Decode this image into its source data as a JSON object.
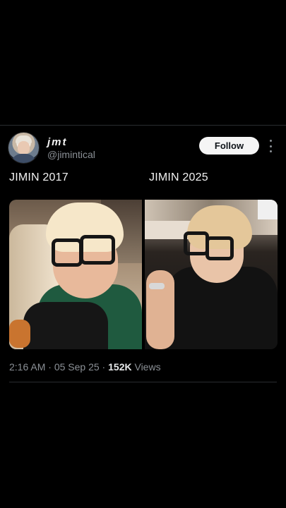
{
  "post": {
    "author": {
      "display_name": "jmt",
      "handle": "@jimintical"
    },
    "follow_label": "Follow",
    "more_icon": "more-vertical-icon",
    "captions": {
      "left": "JIMIN 2017",
      "right": "JIMIN 2025"
    },
    "meta": {
      "time": "2:16 AM",
      "separator1": " · ",
      "date": "05 Sep 25",
      "separator2": " · ",
      "views_count": "152K",
      "views_label": " Views"
    }
  },
  "colors": {
    "background": "#000000",
    "text": "#e7e9ea",
    "muted": "#8b9096",
    "follow_bg": "#f5f5f5"
  }
}
